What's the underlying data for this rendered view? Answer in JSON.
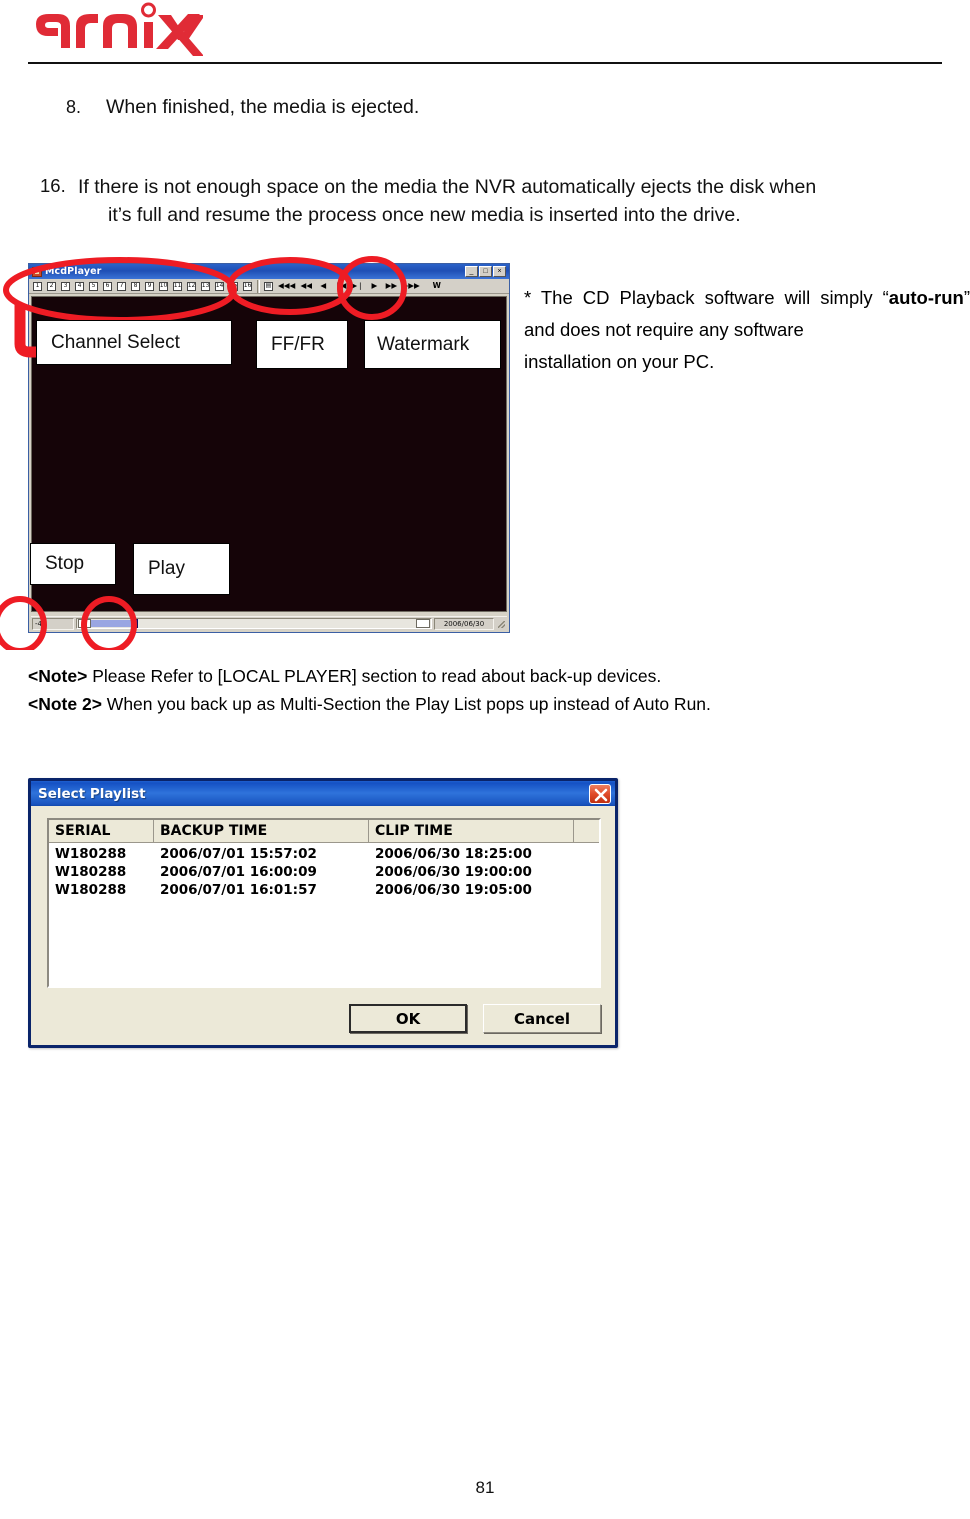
{
  "header": {
    "logo_text": "arnix",
    "logo_color": "#e02b36"
  },
  "content": {
    "item8_number": "8.",
    "item8_text": "When finished, the media is ejected.",
    "item16_number": "16.",
    "item16_line1": "If there is not enough space on the media the NVR automatically ejects the disk when",
    "item16_line2": "it’s full and resume the process once new media is inserted into the drive."
  },
  "side_note": {
    "lead": "* The CD Playback software will simply “",
    "bold1": "auto-",
    "bold2": "run",
    "mid": "”  and  does  not  require  any  software",
    "last": "installation on your PC."
  },
  "player": {
    "title": "McdPlayer",
    "titlebar_buttons": [
      {
        "name": "minimize",
        "glyph": "_"
      },
      {
        "name": "maximize",
        "glyph": "□"
      },
      {
        "name": "close",
        "glyph": "×"
      }
    ],
    "channel_buttons": [
      "1",
      "2",
      "3",
      "4",
      "5",
      "6",
      "7",
      "8",
      "9",
      "10",
      "11",
      "12",
      "13",
      "14",
      "15",
      "16"
    ],
    "transport_buttons": [
      {
        "name": "save-icon",
        "glyph": "▤"
      },
      {
        "name": "rewind-fastest-icon",
        "glyph": "◀◀◀"
      },
      {
        "name": "rewind-fast-icon",
        "glyph": "◀◀"
      },
      {
        "name": "rewind-icon",
        "glyph": "◀"
      },
      {
        "name": "step-back-icon",
        "glyph": "❘◀"
      },
      {
        "name": "step-forward-icon",
        "glyph": "▶❘"
      },
      {
        "name": "play-icon",
        "glyph": "▶"
      },
      {
        "name": "forward-fast-icon",
        "glyph": "▶▶"
      },
      {
        "name": "forward-fastest-icon",
        "glyph": "▶▶▶"
      }
    ],
    "watermark_button_label": "W",
    "status": {
      "speed": "-4X",
      "date": "2006/06/30"
    }
  },
  "callouts": {
    "channel_select": "Channel Select",
    "ff_fr": "FF/FR",
    "watermark": "Watermark",
    "stop": "Stop",
    "play": "Play"
  },
  "notes": {
    "note1_label": "<Note>",
    "note1_text": " Please Refer to [LOCAL PLAYER] section to read about back-up devices.",
    "note2_label": "<Note 2>",
    "note2_text": " When you back up as Multi-Section the Play List pops up instead of Auto Run."
  },
  "playlist_dialog": {
    "title": "Select Playlist",
    "columns": [
      "SERIAL",
      "BACKUP TIME",
      "CLIP TIME",
      ""
    ],
    "rows": [
      {
        "serial": "W180288",
        "backup_time": "2006/07/01 15:57:02",
        "clip_time": "2006/06/30 18:25:00"
      },
      {
        "serial": "W180288",
        "backup_time": "2006/07/01 16:00:09",
        "clip_time": "2006/06/30 19:00:00"
      },
      {
        "serial": "W180288",
        "backup_time": "2006/07/01 16:01:57",
        "clip_time": "2006/06/30 19:05:00"
      }
    ],
    "ok_label": "OK",
    "cancel_label": "Cancel"
  },
  "footer": {
    "page_number": "81"
  },
  "colors": {
    "brand_red": "#e02b36",
    "annotation_red": "#ee1c24",
    "dialog_blue": "#0a246a",
    "titlebar_blue": "#1f5fd0"
  }
}
